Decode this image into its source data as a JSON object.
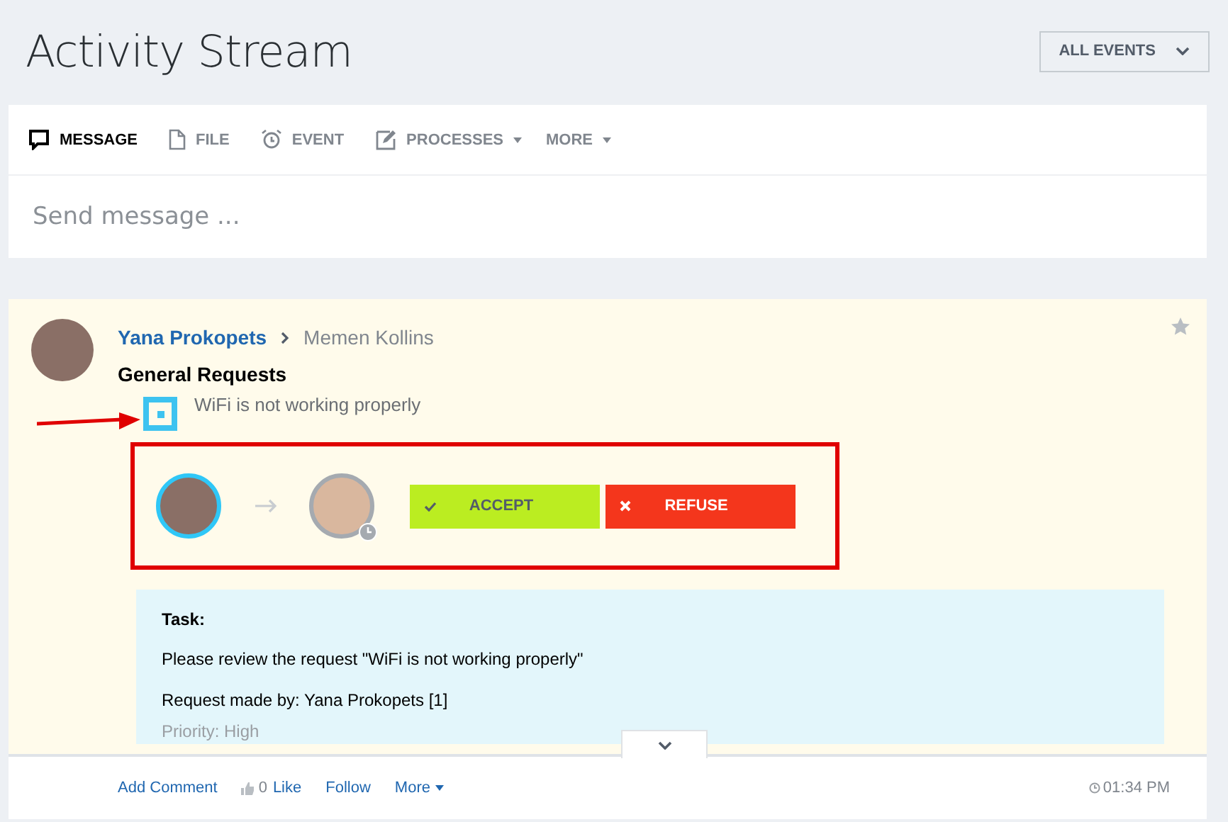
{
  "header": {
    "title": "Activity Stream",
    "filter": "ALL EVENTS"
  },
  "composer": {
    "tabs": [
      {
        "label": "MESSAGE",
        "kind": "message",
        "selected": true,
        "dropdown": false
      },
      {
        "label": "FILE",
        "kind": "file",
        "selected": false,
        "dropdown": false
      },
      {
        "label": "EVENT",
        "kind": "event",
        "selected": false,
        "dropdown": false
      },
      {
        "label": "PROCESSES",
        "kind": "process",
        "selected": false,
        "dropdown": true
      },
      {
        "label": "MORE",
        "kind": "more",
        "selected": false,
        "dropdown": true
      }
    ],
    "placeholder": "Send message ..."
  },
  "post": {
    "author": "Yana Prokopets",
    "recipient": "Memen Kollins",
    "title": "General Requests",
    "subject": "WiFi is not working properly",
    "approval": {
      "accept": "ACCEPT",
      "refuse": "REFUSE"
    },
    "task": {
      "heading": "Task:",
      "lines": [
        {
          "text": "Please review the request \"WiFi is not working properly\"",
          "faded": false
        },
        {
          "text": "Request made by: Yana Prokopets [1]",
          "faded": false
        },
        {
          "text": "Priority: High",
          "faded": true
        }
      ]
    },
    "footer": {
      "actions": [
        {
          "label": "Add Comment",
          "kind": "link"
        },
        {
          "label": "Like",
          "kind": "like",
          "count": "0"
        },
        {
          "label": "Follow",
          "kind": "link"
        },
        {
          "label": "More",
          "kind": "menu"
        }
      ],
      "time": "01:34 PM"
    }
  }
}
